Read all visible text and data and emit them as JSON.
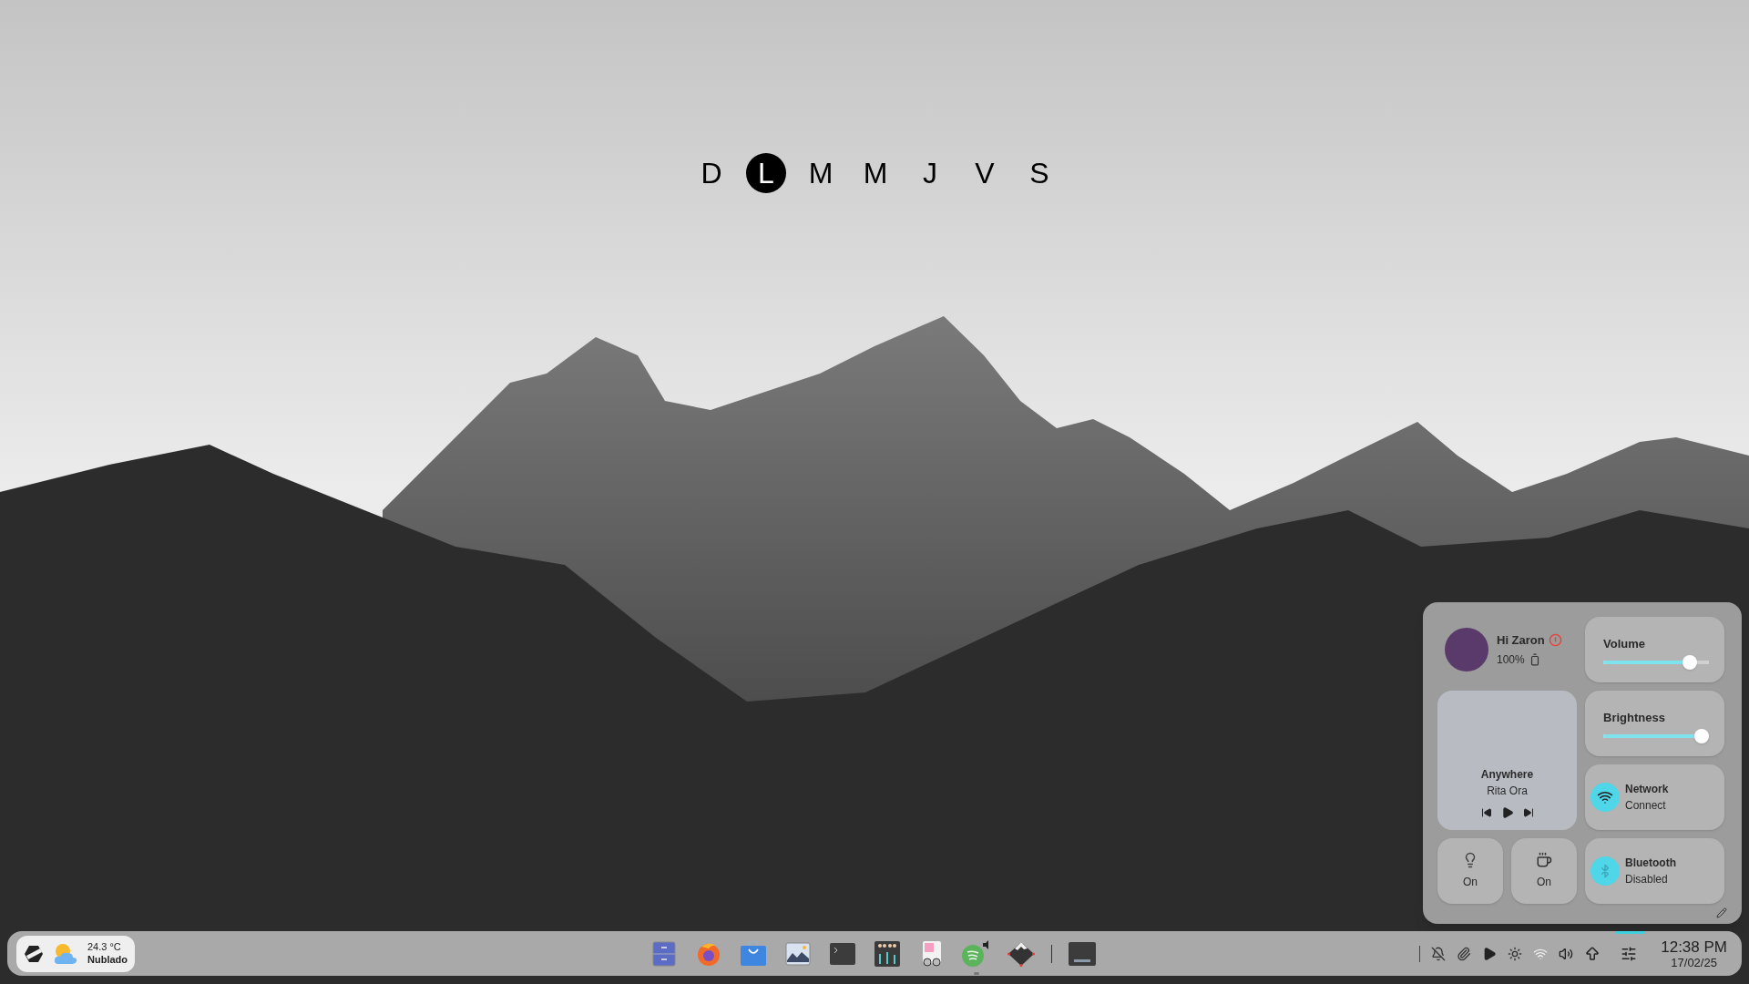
{
  "calendar": {
    "days": [
      {
        "label": "D",
        "selected": false
      },
      {
        "label": "L",
        "selected": true
      },
      {
        "label": "M",
        "selected": false
      },
      {
        "label": "M",
        "selected": false
      },
      {
        "label": "J",
        "selected": false
      },
      {
        "label": "V",
        "selected": false
      },
      {
        "label": "S",
        "selected": false
      }
    ]
  },
  "panel": {
    "user": {
      "greeting": "Hi Zaron",
      "battery": "100%"
    },
    "volume": {
      "label": "Volume",
      "level": 0.82
    },
    "brightness": {
      "label": "Brightness",
      "level": 0.95
    },
    "media": {
      "title": "Anywhere",
      "artist": "Rita Ora"
    },
    "network": {
      "label": "Network",
      "status": "Connect"
    },
    "bluetooth": {
      "label": "Bluetooth",
      "status": "Disabled"
    },
    "toggles": [
      {
        "kind": "bulb",
        "label": "On"
      },
      {
        "kind": "cup",
        "label": "On"
      }
    ]
  },
  "taskbar": {
    "weather": {
      "temperature": "24.3 °C",
      "condition": "Nublado"
    },
    "apps": [
      {
        "kind": "files",
        "running": false
      },
      {
        "kind": "browser",
        "running": false
      },
      {
        "kind": "store",
        "running": false
      },
      {
        "kind": "images",
        "running": false
      },
      {
        "kind": "terminal",
        "running": false
      },
      {
        "kind": "mixer",
        "running": false
      },
      {
        "kind": "document",
        "running": false
      },
      {
        "kind": "music",
        "running": true
      },
      {
        "kind": "mountain",
        "running": false
      },
      {
        "kind": "drive",
        "running": false
      }
    ],
    "clock": {
      "time": "12:38 PM",
      "date": "17/02/25"
    }
  }
}
